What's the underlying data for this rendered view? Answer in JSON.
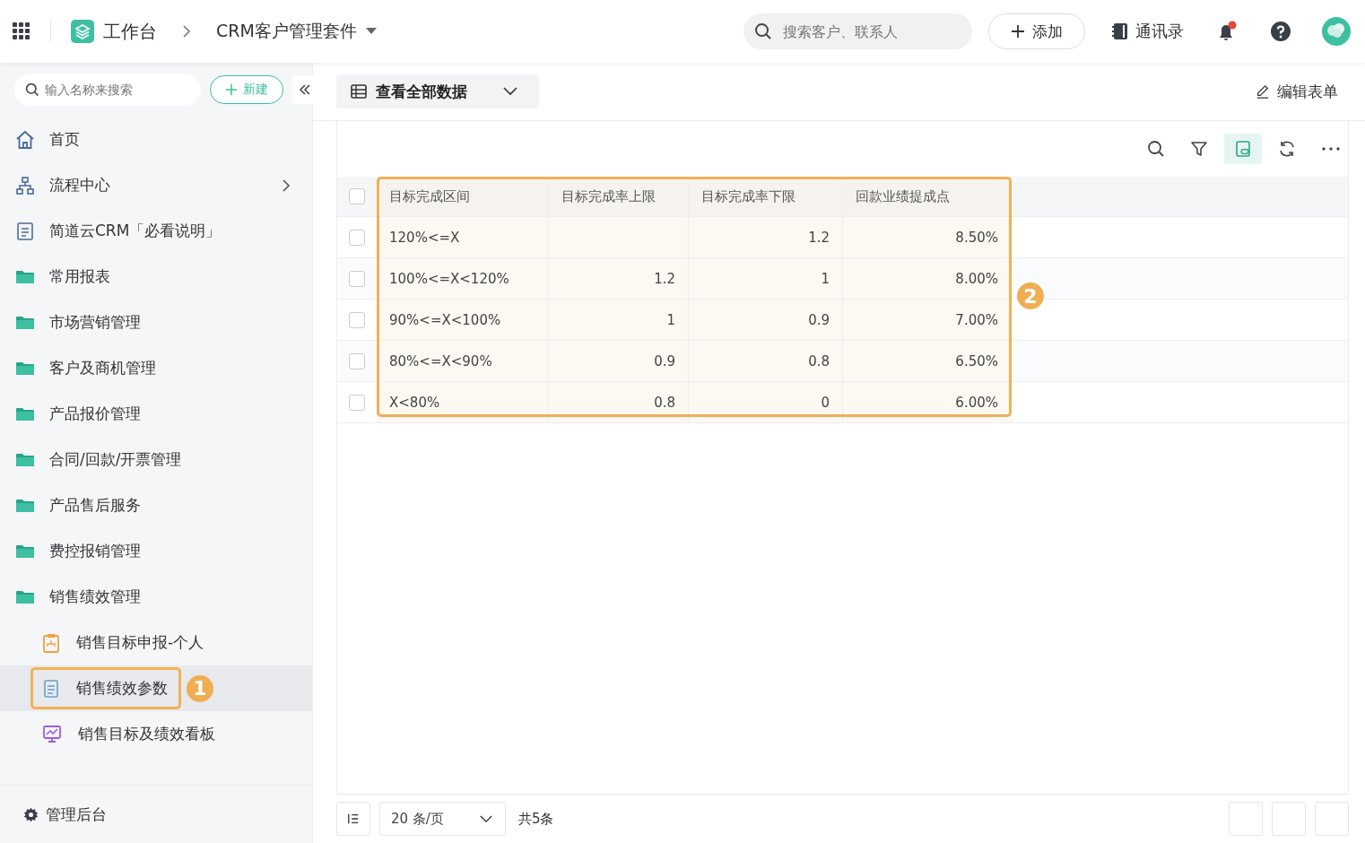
{
  "topbar": {
    "workspace": "工作台",
    "app_name": "CRM客户管理套件",
    "search": {
      "placeholder": "搜索客户、联系人"
    },
    "add_button": "添加",
    "contacts": "通讯录",
    "has_notification": true
  },
  "sidebar": {
    "search": {
      "placeholder": "输入名称来搜索"
    },
    "new_button": "新建",
    "items": [
      {
        "kind": "home",
        "label": "首页",
        "selected": false
      },
      {
        "kind": "flow",
        "label": "流程中心",
        "selected": false
      },
      {
        "kind": "doc",
        "label": "简道云CRM「必看说明」",
        "selected": false
      },
      {
        "kind": "folder",
        "label": "常用报表",
        "selected": false
      },
      {
        "kind": "folder",
        "label": "市场营销管理",
        "selected": false
      },
      {
        "kind": "folder",
        "label": "客户及商机管理",
        "selected": false
      },
      {
        "kind": "folder",
        "label": "产品报价管理",
        "selected": false
      },
      {
        "kind": "folder",
        "label": "合同/回款/开票管理",
        "selected": false
      },
      {
        "kind": "folder",
        "label": "产品售后服务",
        "selected": false
      },
      {
        "kind": "folder",
        "label": "费控报销管理",
        "selected": false
      },
      {
        "kind": "folder",
        "label": "销售绩效管理",
        "selected": false,
        "children": [
          {
            "kind": "form",
            "label": "销售目标申报-个人",
            "selected": false
          },
          {
            "kind": "sheet",
            "label": "销售绩效参数",
            "selected": true,
            "callout": "1"
          },
          {
            "kind": "dashboard",
            "label": "销售目标及绩效看板",
            "selected": false
          }
        ]
      }
    ],
    "footer": "管理后台"
  },
  "view": {
    "title": "查看全部数据",
    "edit_button": "编辑表单"
  },
  "table": {
    "callout": "2",
    "all_checked": false,
    "columns": [
      {
        "label": "目标完成区间",
        "kind": "text",
        "highlighted": true
      },
      {
        "label": "目标完成率上限",
        "kind": "number",
        "highlighted": true
      },
      {
        "label": "目标完成率下限",
        "kind": "number",
        "highlighted": true
      },
      {
        "label": "回款业绩提成点",
        "kind": "number",
        "highlighted": true
      }
    ],
    "rows": [
      {
        "checked": false,
        "cells": [
          "120%<=X",
          "",
          "1.2",
          "8.50%"
        ]
      },
      {
        "checked": false,
        "cells": [
          "100%<=X<120%",
          "1.2",
          "1",
          "8.00%"
        ]
      },
      {
        "checked": false,
        "cells": [
          "90%<=X<100%",
          "1",
          "0.9",
          "7.00%"
        ]
      },
      {
        "checked": false,
        "cells": [
          "80%<=X<90%",
          "0.9",
          "0.8",
          "6.50%"
        ]
      },
      {
        "checked": false,
        "cells": [
          "X<80%",
          "0.8",
          "0",
          "6.00%"
        ]
      }
    ]
  },
  "pagination": {
    "page_size": "20 条/页",
    "total": "共5条"
  }
}
